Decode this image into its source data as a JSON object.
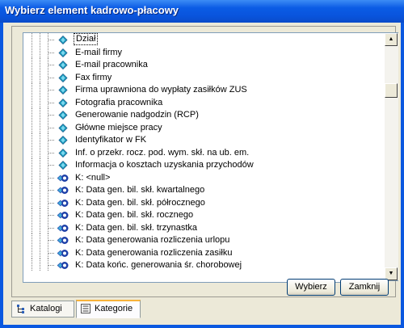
{
  "window": {
    "title": "Wybierz element kadrowo-płacowy"
  },
  "tree": {
    "items": [
      {
        "label": "Dział",
        "kind": "field",
        "selected": true
      },
      {
        "label": "E-mail firmy",
        "kind": "field"
      },
      {
        "label": "E-mail pracownika",
        "kind": "field"
      },
      {
        "label": "Fax firmy",
        "kind": "field"
      },
      {
        "label": "Firma uprawniona do wypłaty zasiłków ZUS",
        "kind": "field"
      },
      {
        "label": "Fotografia pracownika",
        "kind": "field"
      },
      {
        "label": "Generowanie nadgodzin (RCP)",
        "kind": "field"
      },
      {
        "label": "Główne miejsce pracy",
        "kind": "field"
      },
      {
        "label": "Identyfikator w FK",
        "kind": "field"
      },
      {
        "label": "Inf. o przekr. rocz. pod. wym. skł. na ub. em.",
        "kind": "field"
      },
      {
        "label": "Informacja o kosztach uzyskania przychodów",
        "kind": "field"
      },
      {
        "label": "K: <null>",
        "kind": "key"
      },
      {
        "label": "K: Data gen. bil. skł. kwartalnego",
        "kind": "key"
      },
      {
        "label": "K: Data gen. bil. skł. półrocznego",
        "kind": "key"
      },
      {
        "label": "K: Data gen. bil. skł. rocznego",
        "kind": "key"
      },
      {
        "label": "K: Data gen. bil. skł. trzynastka",
        "kind": "key"
      },
      {
        "label": "K: Data generowania rozliczenia urlopu",
        "kind": "key"
      },
      {
        "label": "K: Data generowania rozliczenia zasiłku",
        "kind": "key"
      },
      {
        "label": "K: Data końc. generowania śr. chorobowej",
        "kind": "key"
      }
    ]
  },
  "buttons": {
    "select_label": "Wybierz",
    "close_label": "Zamknij"
  },
  "tabs": [
    {
      "label": "Katalogi",
      "icon": "tree-icon",
      "active": false
    },
    {
      "label": "Kategorie",
      "icon": "list-icon",
      "active": true
    }
  ],
  "colors": {
    "title_bar": "#0a58e0",
    "dialog_bg": "#ece9d8",
    "field_icon": "#1a9fbf",
    "key_icon": "#1d3fa8"
  }
}
